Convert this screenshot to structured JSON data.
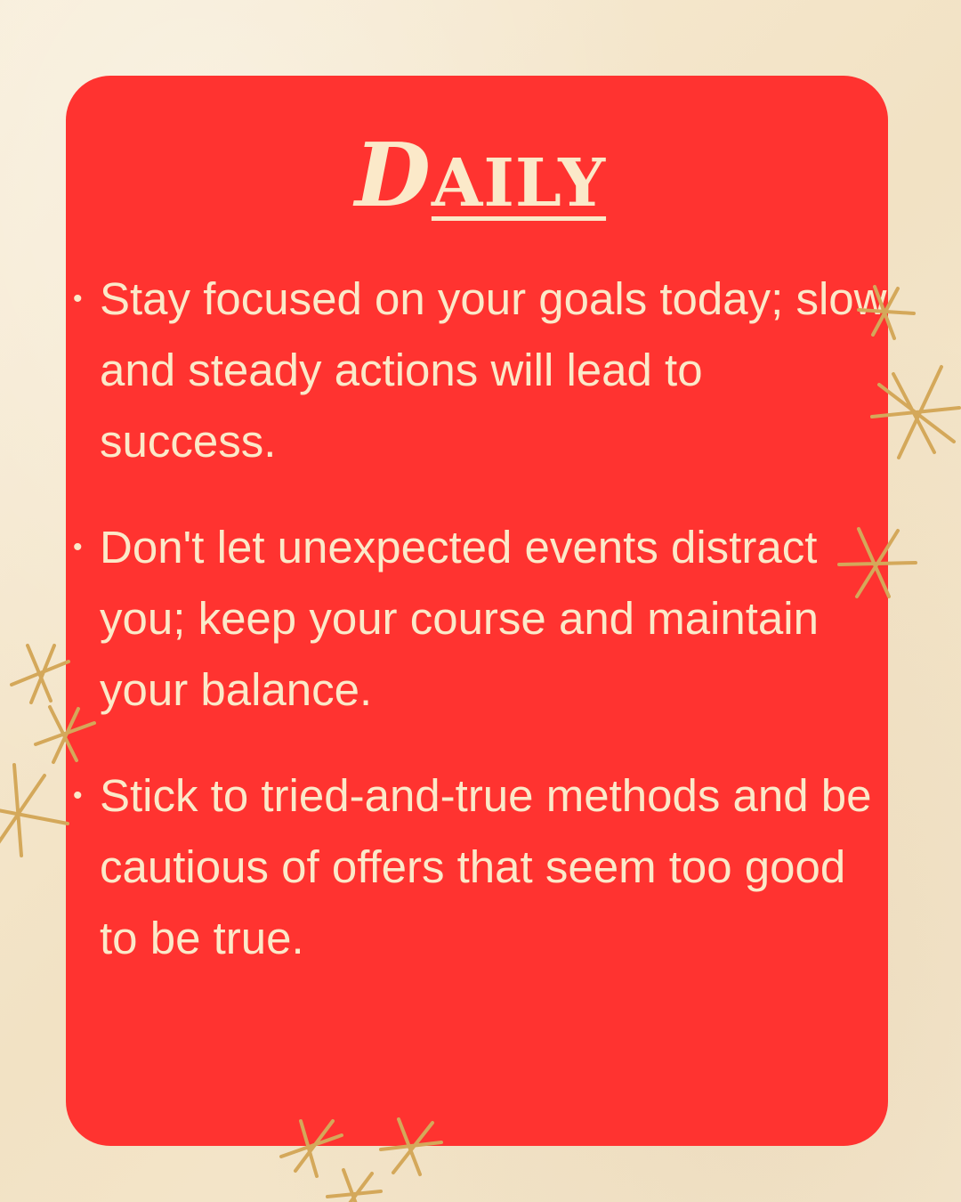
{
  "title": {
    "first_letter": "D",
    "rest": "AILY"
  },
  "bullets": [
    {
      "bullet_icon": "bullet-dot-icon",
      "text": "Stay focused on your goals today; slow and steady actions will lead to success."
    },
    {
      "bullet_icon": "bullet-dot-icon",
      "text": "Don't let unexpected events distract you; keep your course and maintain your balance."
    },
    {
      "bullet_icon": "bullet-dot-icon",
      "text": "Stick to tried-and-true methods and be cautious of offers that seem too good to be true."
    }
  ],
  "decorations": {
    "icon": "sparkle-star-icon",
    "color": "#d4a85a"
  },
  "colors": {
    "background": "#f5e8cf",
    "card": "#ff3330",
    "text": "#fbe9c9"
  }
}
